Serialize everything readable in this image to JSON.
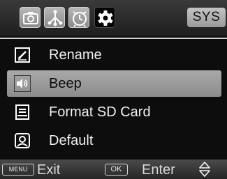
{
  "tabs": [
    {
      "icon": "camera-icon",
      "active": false
    },
    {
      "icon": "network-icon",
      "active": false
    },
    {
      "icon": "timer-icon",
      "active": false
    },
    {
      "icon": "gear-icon",
      "active": true
    }
  ],
  "header": {
    "sys_label": "SYS"
  },
  "menu": {
    "items": [
      {
        "label": "Rename",
        "icon": "edit-icon",
        "selected": false
      },
      {
        "label": "Beep",
        "icon": "speaker-icon",
        "selected": true
      },
      {
        "label": "Format SD Card",
        "icon": "sd-card-icon",
        "selected": false
      },
      {
        "label": "Default",
        "icon": "reset-icon",
        "selected": false
      }
    ]
  },
  "footer": {
    "menu_key": "MENU",
    "exit_label": "Exit",
    "ok_key": "OK",
    "enter_label": "Enter",
    "nav_icon": "up-down-arrows-icon"
  },
  "colors": {
    "screen_bg": "#0d0d0d",
    "highlight": "#9c9c9c",
    "text_light": "#f0f0f0",
    "text_dark": "#0c0c0c"
  }
}
